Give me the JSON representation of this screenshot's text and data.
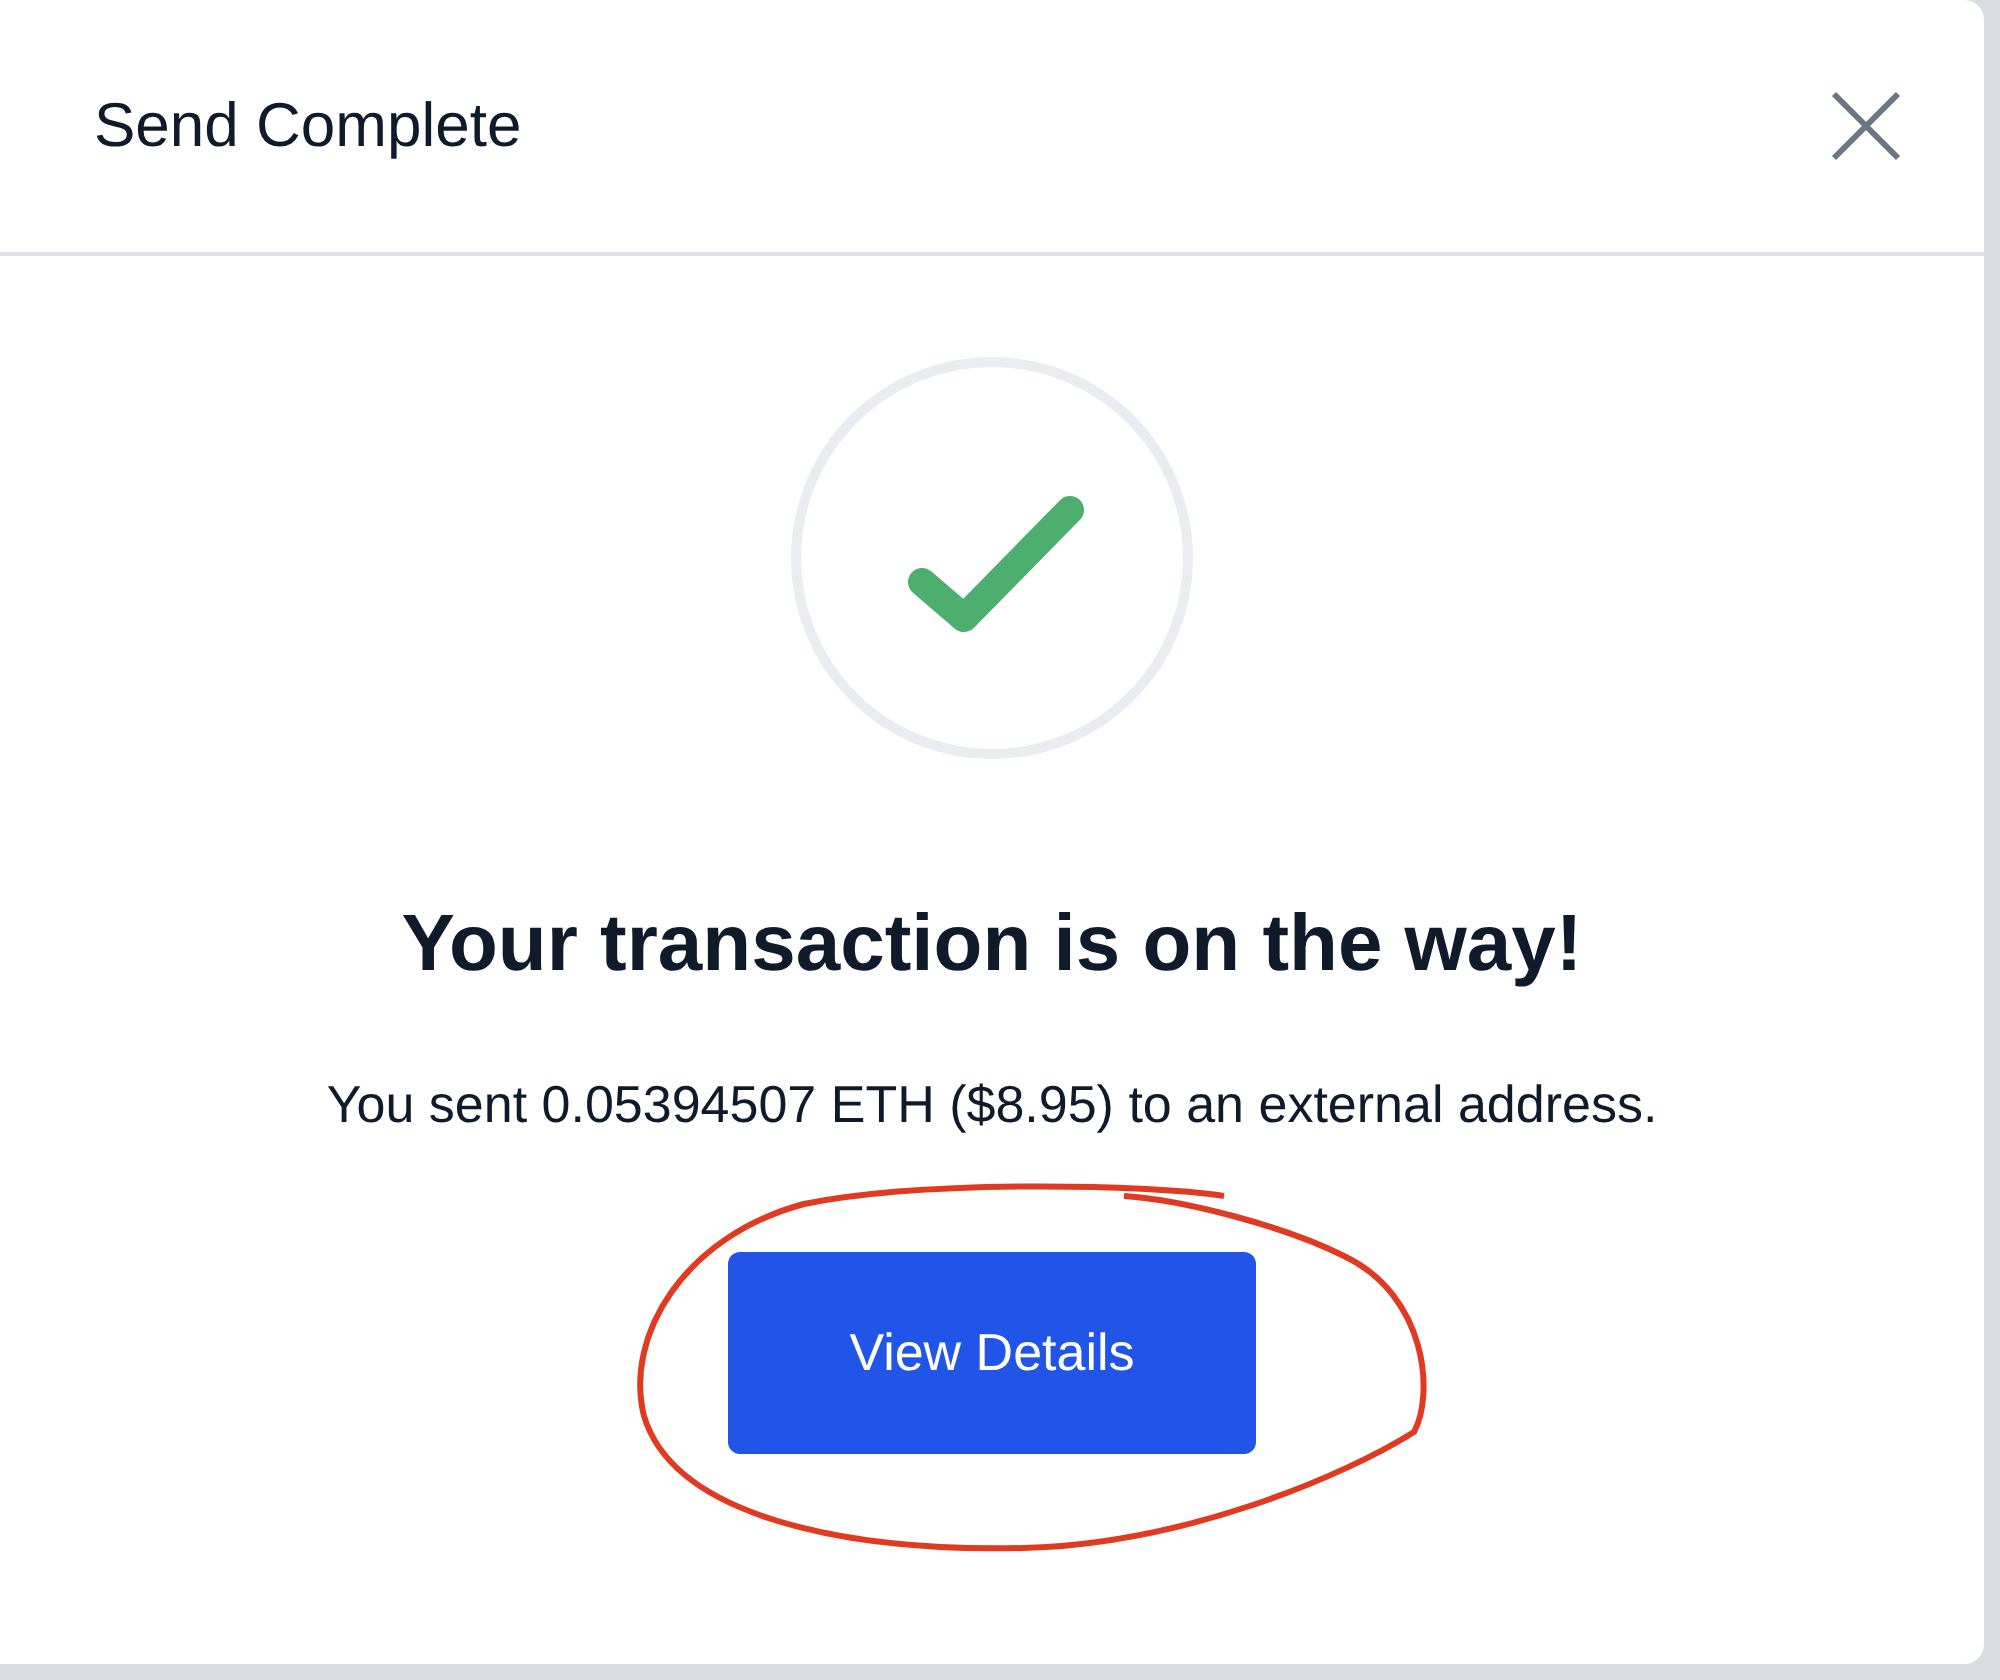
{
  "dialog": {
    "title": "Send Complete",
    "heading": "Your transaction is on the way!",
    "message": "You sent 0.05394507 ETH ($8.95) to an external address.",
    "button": "View Details"
  }
}
